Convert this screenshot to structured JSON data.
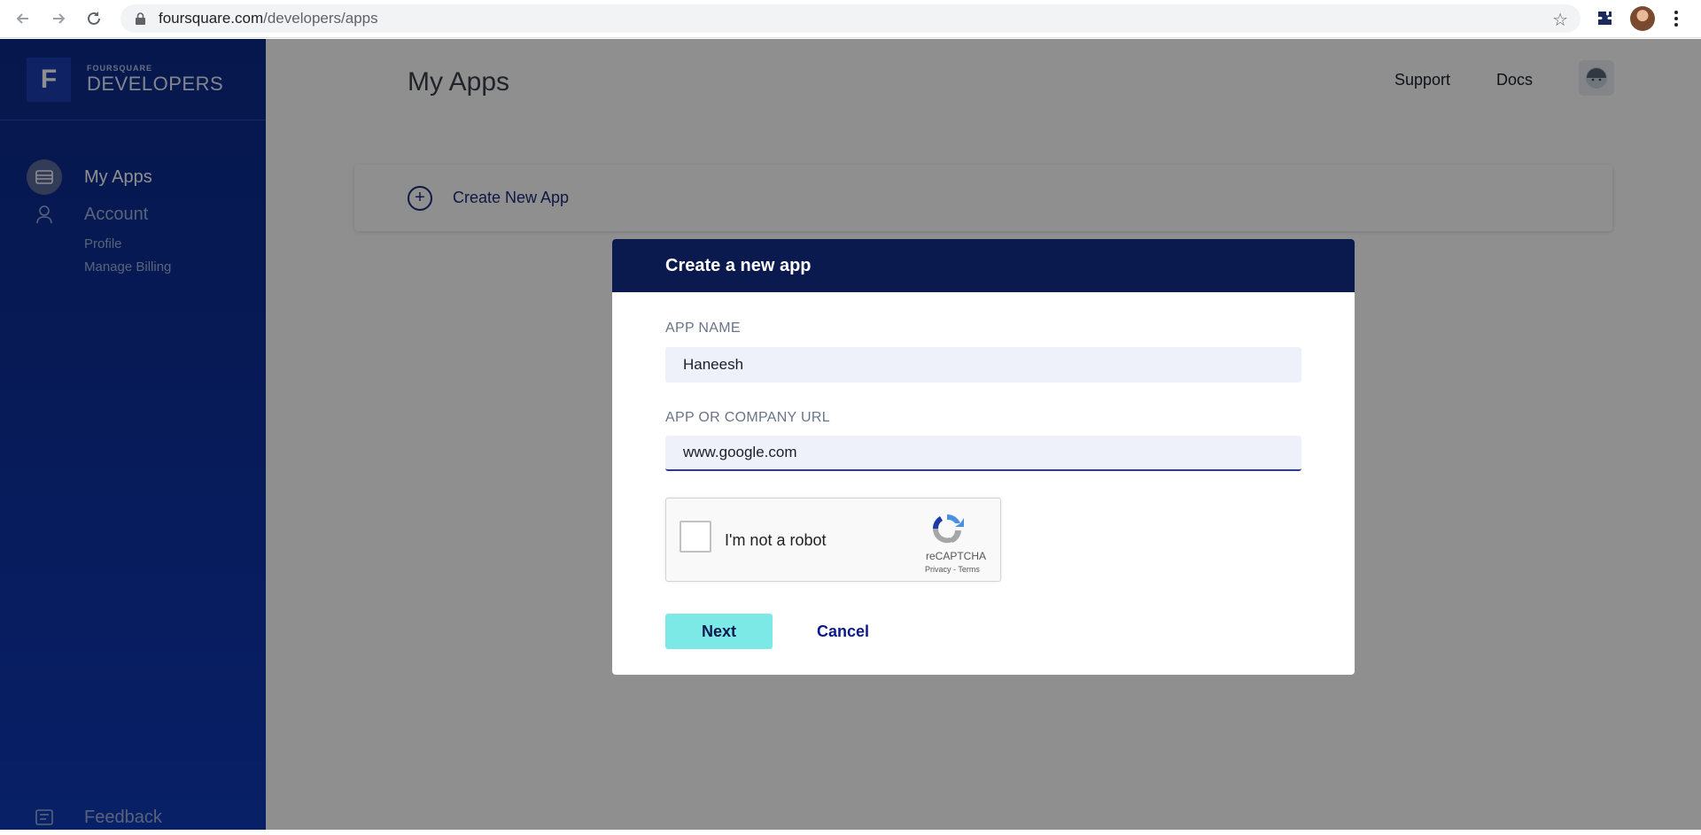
{
  "browser": {
    "url_host": "foursquare.com",
    "url_path": "/developers/apps"
  },
  "sidebar": {
    "logo_letter": "F",
    "logo_small": "FOURSQUARE",
    "logo_big": "DEVELOPERS",
    "items": [
      {
        "label": "My Apps",
        "icon": "apps-icon",
        "active": true
      },
      {
        "label": "Account",
        "icon": "user-icon",
        "active": false
      }
    ],
    "sub_items": [
      "Profile",
      "Manage Billing"
    ],
    "feedback_label": "Feedback"
  },
  "main": {
    "title": "My Apps",
    "top_links": [
      "Support",
      "Docs"
    ],
    "create_label": "Create New App"
  },
  "modal": {
    "title": "Create a new app",
    "app_name_label": "APP NAME",
    "app_name_value": "Haneesh",
    "url_label": "APP OR COMPANY URL",
    "url_value": "www.google.com",
    "captcha_text": "I'm not a robot",
    "captcha_brand": "reCAPTCHA",
    "captcha_links": "Privacy - Terms",
    "next_label": "Next",
    "cancel_label": "Cancel"
  }
}
